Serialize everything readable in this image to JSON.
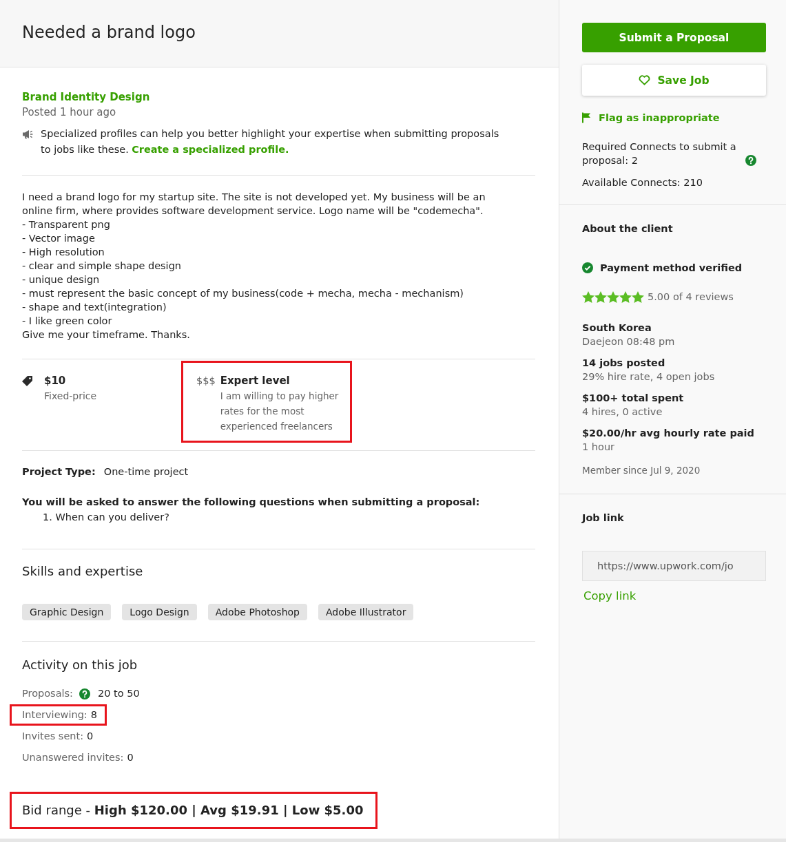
{
  "header": {
    "title": "Needed a brand logo"
  },
  "overview": {
    "category": "Brand Identity Design",
    "posted": "Posted 1 hour ago",
    "notice": {
      "text": "Specialized profiles can help you better highlight your expertise when submitting proposals to jobs like these.",
      "link": "Create a specialized profile."
    }
  },
  "description": {
    "lines": [
      "I need a brand logo for my startup site. The site is not developed yet. My business will be an online firm, where provides software development service. Logo name will be \"codemecha\".",
      "- Transparent png",
      "- Vector image",
      "- High resolution",
      "- clear and simple shape design",
      "- unique design",
      "- must represent the basic concept of my business(code + mecha, mecha - mechanism)",
      "- shape and text(integration)",
      "- I like green color",
      "Give me your timeframe. Thanks."
    ]
  },
  "terms": [
    {
      "kind": "price",
      "title": "$10",
      "subtitle": "Fixed-price",
      "highlighted": false
    },
    {
      "kind": "level",
      "symbol": "$$$",
      "title": "Expert level",
      "subtitle": "I am willing to pay higher rates for the most experienced freelancers",
      "highlighted": true
    }
  ],
  "details": {
    "project_type": {
      "label": "Project Type:",
      "value": "One-time project"
    },
    "questions": {
      "intro": "You will be asked to answer the following questions when submitting a proposal:",
      "items": [
        "1. When can you deliver?"
      ]
    }
  },
  "skills": {
    "title": "Skills and expertise",
    "tags": [
      "Graphic Design",
      "Logo Design",
      "Adobe Photoshop",
      "Adobe Illustrator"
    ]
  },
  "activity": {
    "title": "Activity on this job",
    "stats": [
      {
        "label": "Proposals:",
        "value": "20 to 50",
        "help": true,
        "highlighted": false
      },
      {
        "label": "Interviewing:",
        "value": "8",
        "help": false,
        "highlighted": true
      },
      {
        "label": "Invites sent:",
        "value": "0",
        "help": false,
        "highlighted": false
      },
      {
        "label": "Unanswered invites:",
        "value": "0",
        "help": false,
        "highlighted": false
      }
    ],
    "bid_range": {
      "text": "Bid range - **High $120.00 | Avg $19.91 | Low $5.00**",
      "highlighted": true
    }
  },
  "sidebar": {
    "actions": {
      "submit": "Submit a Proposal",
      "save": "Save Job",
      "flag": "Flag as inappropriate"
    },
    "connects": {
      "required": "Required Connects to submit a proposal: 2",
      "available": "Available Connects: 210"
    },
    "client": {
      "title": "About the client",
      "payment": "Payment method verified",
      "payment_verified": true,
      "stars": 5,
      "rating": "5.00 of 4 reviews",
      "facts": [
        {
          "title": "South Korea",
          "detail": "Daejeon 08:48 pm"
        },
        {
          "title": "14 jobs posted",
          "detail": "29% hire rate, 4 open jobs"
        },
        {
          "title": "$100+ total spent",
          "detail": "4 hires, 0 active"
        },
        {
          "title": "$20.00/hr avg hourly rate paid",
          "detail": "1 hour"
        }
      ],
      "member_since": "Member since Jul 9, 2020"
    },
    "job_link": {
      "title": "Job link",
      "url": "https://www.upwork.com/jo",
      "copy": "Copy link"
    }
  }
}
